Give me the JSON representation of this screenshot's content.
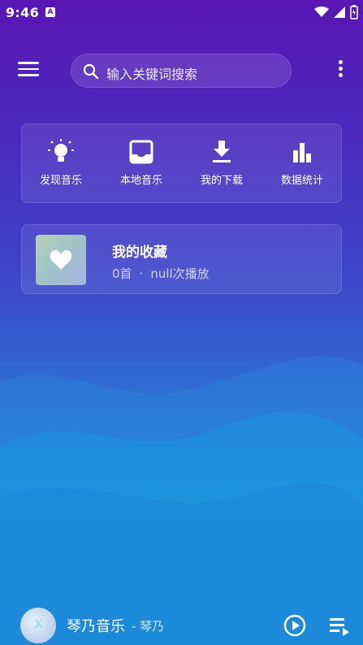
{
  "status_bar": {
    "time": "9:46",
    "notification_glyph": "A",
    "icons": [
      "wifi-icon",
      "signal-icon",
      "battery-icon"
    ]
  },
  "topbar": {
    "menu_icon": "menu-icon",
    "search_placeholder": "输入关键词搜索",
    "more_icon": "more-vert-icon"
  },
  "quick_actions": [
    {
      "label": "发现音乐",
      "icon": "lightbulb-icon"
    },
    {
      "label": "本地音乐",
      "icon": "inbox-icon"
    },
    {
      "label": "我的下载",
      "icon": "download-icon"
    },
    {
      "label": "数据统计",
      "icon": "bar-chart-icon"
    }
  ],
  "favorites": {
    "title": "我的收藏",
    "count": "0首",
    "separator": "·",
    "plays": "null次播放",
    "icon": "heart-icon"
  },
  "player": {
    "track": "琴乃音乐",
    "artist": "- 琴乃",
    "cover_glyph": "X",
    "play_icon": "play-icon",
    "queue_icon": "queue-icon"
  },
  "colors": {
    "bg_top": "#5a15b4",
    "bg_bottom": "#1c84d4",
    "text": "#ffffff"
  }
}
